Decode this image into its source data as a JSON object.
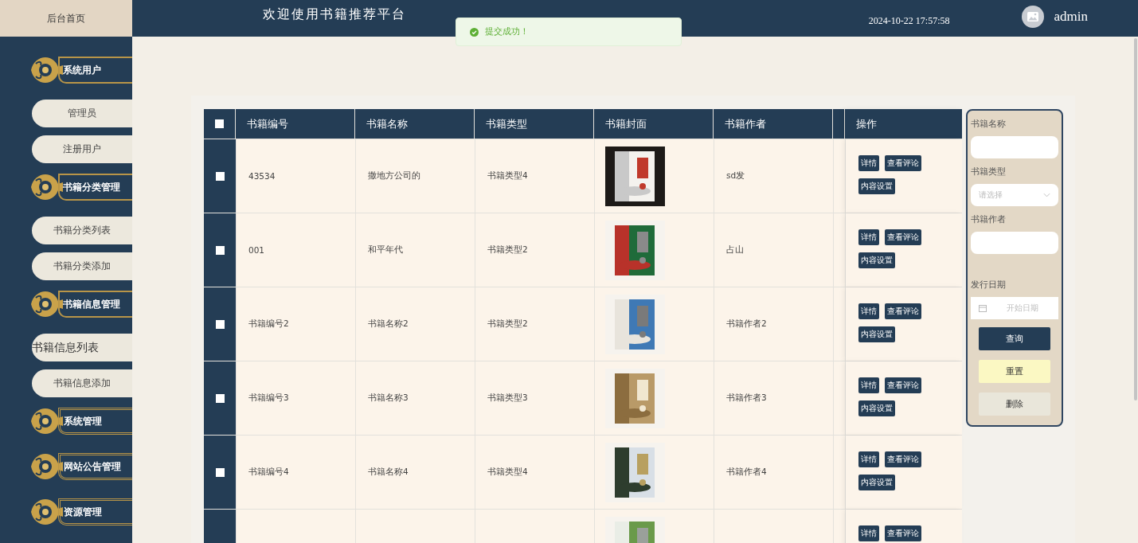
{
  "sidebar": {
    "home": "后台首页",
    "groups": [
      {
        "label": "系统用户",
        "expanded": true,
        "children": [
          {
            "label": "管理员",
            "selected": false
          },
          {
            "label": "注册用户",
            "selected": false
          }
        ]
      },
      {
        "label": "书籍分类管理",
        "expanded": true,
        "children": [
          {
            "label": "书籍分类列表",
            "selected": false
          },
          {
            "label": "书籍分类添加",
            "selected": false
          }
        ]
      },
      {
        "label": "书籍信息管理",
        "expanded": true,
        "children": [
          {
            "label": "书籍信息列表",
            "selected": true
          },
          {
            "label": "书籍信息添加",
            "selected": false
          }
        ]
      },
      {
        "label": "系统管理",
        "expanded": false
      },
      {
        "label": "网站公告管理",
        "expanded": false
      },
      {
        "label": "资源管理",
        "expanded": false
      }
    ]
  },
  "header": {
    "title": "欢迎使用书籍推荐平台",
    "datetime": "2024-10-22 17:57:58",
    "user": "admin"
  },
  "toast": {
    "kind": "success",
    "message": "提交成功！"
  },
  "table": {
    "select_all": {
      "checked": false
    },
    "columns": [
      "书籍编号",
      "书籍名称",
      "书籍类型",
      "书籍封面",
      "书籍作者",
      "操作"
    ],
    "rows": [
      {
        "checked": false,
        "id": "43534",
        "name": "撒地方公司的",
        "type": "书籍类型4",
        "author": "sd发",
        "actions": [
          "详情",
          "查看评论",
          "内容设置"
        ]
      },
      {
        "checked": false,
        "id": "001",
        "name": "和平年代",
        "type": "书籍类型2",
        "author": "占山",
        "actions": [
          "详情",
          "查看评论",
          "内容设置"
        ]
      },
      {
        "checked": false,
        "id": "书籍编号2",
        "name": "书籍名称2",
        "type": "书籍类型2",
        "author": "书籍作者2",
        "actions": [
          "详情",
          "查看评论",
          "内容设置"
        ]
      },
      {
        "checked": false,
        "id": "书籍编号3",
        "name": "书籍名称3",
        "type": "书籍类型3",
        "author": "书籍作者3",
        "actions": [
          "详情",
          "查看评论",
          "内容设置"
        ]
      },
      {
        "checked": false,
        "id": "书籍编号4",
        "name": "书籍名称4",
        "type": "书籍类型4",
        "author": "书籍作者4",
        "actions": [
          "详情",
          "查看评论",
          "内容设置"
        ]
      },
      {
        "actions": [
          "详情",
          "查看评论"
        ]
      }
    ]
  },
  "search": {
    "fields": [
      {
        "kind": "text",
        "label": "书籍名称"
      },
      {
        "kind": "select",
        "label": "书籍类型",
        "placeholder": "请选择"
      },
      {
        "kind": "text",
        "label": "书籍作者"
      },
      {
        "kind": "date",
        "label": "发行日期",
        "placeholder": "开始日期"
      }
    ],
    "buttons": [
      {
        "kind": "primary",
        "label": "查询"
      },
      {
        "kind": "warning",
        "label": "重置"
      },
      {
        "kind": "plain",
        "label": "删除"
      }
    ]
  }
}
